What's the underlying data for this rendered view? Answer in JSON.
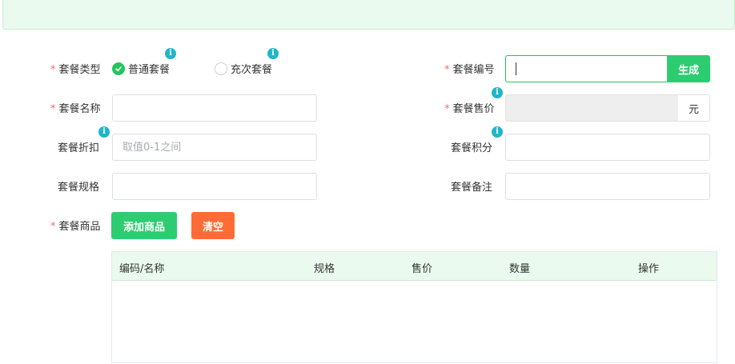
{
  "form": {
    "package_type": {
      "label": "套餐类型",
      "required": "*",
      "options": [
        "普通套餐",
        "充次套餐"
      ],
      "selected": "普通套餐"
    },
    "package_code": {
      "label": "套餐编号",
      "required": "*",
      "value": "",
      "generate_label": "生成"
    },
    "package_name": {
      "label": "套餐名称",
      "required": "*",
      "value": ""
    },
    "package_price": {
      "label": "套餐售价",
      "required": "*",
      "value": "",
      "suffix": "元"
    },
    "package_discount": {
      "label": "套餐折扣",
      "placeholder": "取值0-1之间",
      "value": ""
    },
    "package_points": {
      "label": "套餐积分",
      "value": ""
    },
    "package_spec": {
      "label": "套餐规格",
      "value": ""
    },
    "package_remark": {
      "label": "套餐备注",
      "value": ""
    },
    "package_goods": {
      "label": "套餐商品",
      "required": "*",
      "add_label": "添加商品",
      "clear_label": "清空"
    }
  },
  "table": {
    "columns": [
      "编码/名称",
      "规格",
      "售价",
      "数量",
      "操作"
    ],
    "rows": []
  },
  "icons": {
    "info": "info-icon",
    "check": "check-icon"
  },
  "colors": {
    "primary": "#2ecc71",
    "danger": "#ff6b35",
    "required": "#f56c6c",
    "info": "#1fb6c8",
    "header_bg": "#eafaee"
  }
}
